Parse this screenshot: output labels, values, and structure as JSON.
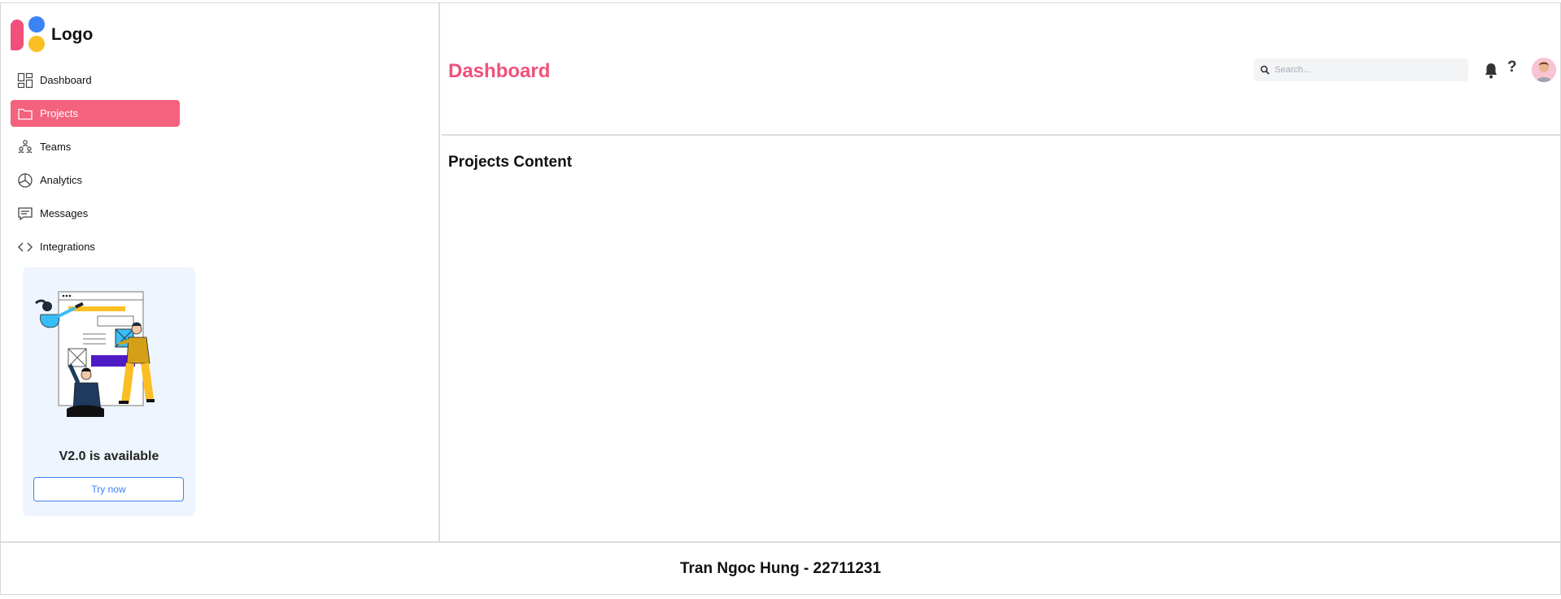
{
  "brand": {
    "logo_text": "Logo"
  },
  "sidebar": {
    "items": [
      {
        "label": "Dashboard",
        "icon": "dashboard-icon"
      },
      {
        "label": "Projects",
        "icon": "folder-icon",
        "active": true
      },
      {
        "label": "Teams",
        "icon": "teams-icon"
      },
      {
        "label": "Analytics",
        "icon": "pie-chart-icon"
      },
      {
        "label": "Messages",
        "icon": "message-icon"
      },
      {
        "label": "Integrations",
        "icon": "code-icon"
      }
    ],
    "promo": {
      "title": "V2.0 is available",
      "button_label": "Try now"
    }
  },
  "header": {
    "title": "Dashboard",
    "search_placeholder": "Search...",
    "help_glyph": "?"
  },
  "main": {
    "content_title": "Projects Content"
  },
  "footer": {
    "text": "Tran Ngoc Hung - 22711231"
  },
  "colors": {
    "accent": "#f0507a",
    "active_nav": "#f5627e",
    "link_blue": "#3b82f6",
    "promo_bg": "#eff5ff"
  }
}
